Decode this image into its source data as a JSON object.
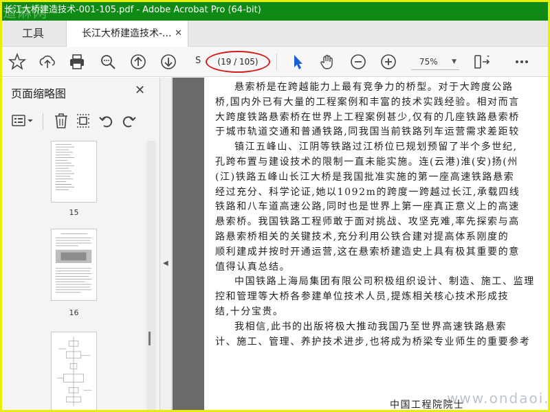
{
  "window": {
    "title": "长江大桥建造技术-001-105.pdf - Adobe Acrobat Pro (64-bit)",
    "watermark": "道麻网"
  },
  "tabs": {
    "tools_label": "工具",
    "doc_label": "长江大桥建造技术-...",
    "doc_close": "✕"
  },
  "toolbar": {
    "page_prefix": "S",
    "page_indicator": "(19 / 105)",
    "zoom": "75%",
    "icons": [
      "star-icon",
      "upload-icon",
      "print-icon",
      "search-icon",
      "page-up-icon",
      "page-down-icon",
      "select-arrow-icon",
      "hand-icon",
      "zoom-out-icon",
      "zoom-in-icon",
      "fit-page-icon",
      "more-icon"
    ]
  },
  "sidebar": {
    "title": "页面缩略图",
    "close": "✕",
    "thumbnails": [
      {
        "label": "15"
      },
      {
        "label": "16"
      },
      {
        "label": ""
      }
    ]
  },
  "document": {
    "lines": [
      "悬索桥是在跨越能力上最有竞争力的桥型。对于大跨度公路",
      "桥,国内外已有大量的工程案例和丰富的技术实践经验。相对而言",
      "大跨度铁路悬索桥在世界上工程案例甚少,仅有的几座铁路悬索桥",
      "于城市轨道交通和普通铁路,同我国当前铁路列车运营需求差距较",
      "镇江五峰山、江阴等铁路过江桥位已规划预留了半个多世纪,",
      "孔跨布置与建设技术的限制一直未能实施。连(云港)淮(安)扬(州",
      "(江)铁路五峰山长江大桥是我国批准实施的第一座高速铁路悬索",
      "经过充分、科学论证,她以1092m的跨度一跨越过长江,承载四线",
      "铁路和八车道高速公路,同时也是世界上第一座真正意义上的高速",
      "悬索桥。我国铁路工程师敢于面对挑战、攻坚克难,率先探索与高",
      "路悬索桥相关的关键技术,充分利用公铁合建对提高体系刚度的",
      "顺利建成并按时开通运营,这在悬索桥建造史上具有极其重要的意",
      "值得认真总结。",
      "中国铁路上海局集团有限公司积极组织设计、制造、施工、监理",
      "控和管理等大桥各参建单位技术人员,提炼相关核心技术形成技",
      "结,十分宝贵。",
      "我相信,此书的出版将极大推动我国乃至世界高速铁路悬索",
      "计、施工、管理、养护技术进步,也将成为桥梁专业师生的重要参考"
    ],
    "signature": "中国工程院院士",
    "watermark": "www.ondaoi.com"
  },
  "colors": {
    "titlebar": "#0f8a14",
    "frame": "#e8f000",
    "annotation": "#d41a1a",
    "select_arrow": "#1a5fd6"
  }
}
